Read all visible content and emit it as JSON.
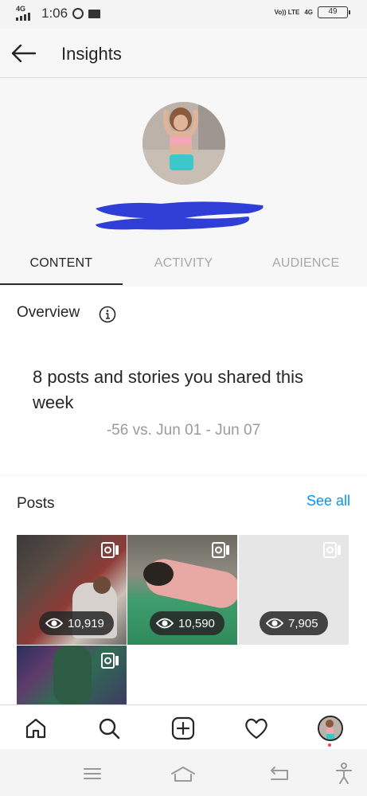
{
  "status_bar": {
    "network": "4G",
    "time": "1:06",
    "volte": "Vo)) LTE",
    "network_right": "4G",
    "battery": "49"
  },
  "header": {
    "back_icon": "arrow-left-icon",
    "title": "Insights"
  },
  "tabs": [
    {
      "label": "CONTENT",
      "active": true
    },
    {
      "label": "ACTIVITY",
      "active": false
    },
    {
      "label": "AUDIENCE",
      "active": false
    }
  ],
  "overview": {
    "title": "Overview",
    "info_icon": "info-icon",
    "summary": "8 posts and stories you shared this week",
    "comparison": "-56 vs. Jun 01 - Jun 07"
  },
  "posts": {
    "title": "Posts",
    "see_all": "See all",
    "items": [
      {
        "views": "10,919",
        "type_icon": "reel-icon"
      },
      {
        "views": "10,590",
        "type_icon": "reel-icon"
      },
      {
        "views": "7,905",
        "type_icon": "reel-icon"
      },
      {
        "views": null,
        "type_icon": "reel-icon"
      }
    ]
  },
  "bottom_nav": [
    "home-icon",
    "search-icon",
    "add-post-icon",
    "heart-icon",
    "profile-avatar"
  ],
  "system_nav": [
    "menu-icon",
    "home-outline-icon",
    "back-icon",
    "accessibility-icon"
  ],
  "colors": {
    "accent_link": "#0095f6",
    "text_primary": "#262626",
    "text_secondary": "#9a9a9a",
    "redaction": "#2f3fd6"
  }
}
